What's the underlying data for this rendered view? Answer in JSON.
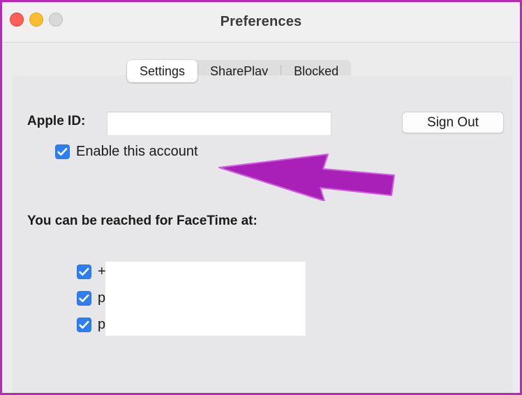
{
  "window": {
    "title": "Preferences",
    "traffic_lights": [
      {
        "name": "close",
        "color": "#ff5f57"
      },
      {
        "name": "minimize",
        "color": "#febc2e"
      },
      {
        "name": "zoom",
        "color": "#d8d8d8"
      }
    ],
    "border_color": "#b52bb5"
  },
  "tabs": [
    {
      "label": "Settings",
      "selected": true
    },
    {
      "label": "SharePlay",
      "selected": false
    },
    {
      "label": "Blocked",
      "selected": false
    }
  ],
  "settings": {
    "apple_id_label": "Apple ID:",
    "apple_id_value": "",
    "apple_id_placeholder": "",
    "sign_out_label": "Sign Out",
    "enable_account": {
      "label": "Enable this account",
      "checked": true
    },
    "reached_heading": "You can be reached for FaceTime at:",
    "reach_items": [
      {
        "text": "+",
        "checked": true
      },
      {
        "text": "p",
        "checked": true
      },
      {
        "text": "p",
        "checked": true
      }
    ]
  },
  "annotation": {
    "arrow_name": "left-pointing-arrow",
    "arrow_color": "#a820b8",
    "arrow_highlight": "#cf5fe0"
  },
  "colors": {
    "checkbox_blue": "#2b7ff2",
    "window_background": "#ececec",
    "panel_background": "#e7e7e9",
    "titlebar_background": "#f0f0f0"
  }
}
